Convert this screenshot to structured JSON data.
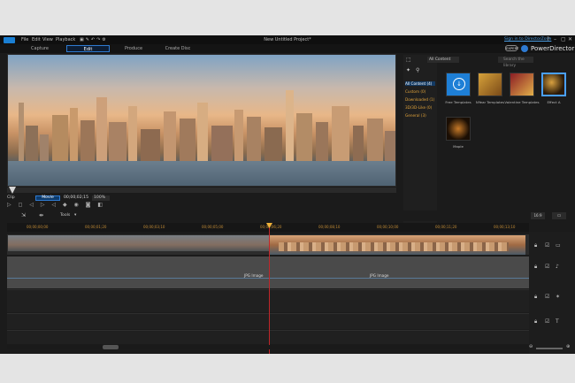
{
  "title_bar": {
    "menu": [
      "File",
      "Edit",
      "View",
      "Playback"
    ],
    "window_title": "New Untitled Project*",
    "sign_in": "Sign in to DirectorZone",
    "window_controls": [
      "?",
      "–",
      "▢",
      "✕"
    ]
  },
  "mode_tabs": [
    "Capture",
    "Edit",
    "Produce",
    "Create Disc"
  ],
  "brand": {
    "expert": "EXPERT",
    "name": "PowerDirector"
  },
  "preview": {
    "mode_clip": "Clip",
    "mode_movie": "Movie",
    "timecode": "00;00;02;15",
    "zoom": "100%",
    "controls": "▷ ◻ ◁ ▷ ◁ ◆ ◉ ◙ ◧"
  },
  "library": {
    "filter": "All Content",
    "search_placeholder": "Search the library",
    "categories": [
      "All Content (4)",
      "Custom (0)",
      "Downloaded (1)",
      "3D/3D-Like (0)",
      "General (3)"
    ],
    "items": [
      {
        "label": "Free Templates",
        "icon": "download-icon"
      },
      {
        "label": "NYear Templates"
      },
      {
        "label": "Valentine Templates"
      },
      {
        "label": "Effect A"
      },
      {
        "label": "Maple"
      }
    ]
  },
  "timeline_toolbar": {
    "tools_label": "Tools",
    "aspect": "16:9"
  },
  "ruler_ticks": [
    "00;00;00;00",
    "00;00;01;20",
    "00;00;03;10",
    "00;00;05;00",
    "00;00;06;20",
    "00;00;08;10",
    "00;00;10;00",
    "00;00;11;20",
    "00;00;13;10"
  ],
  "audio_clips": [
    "JPG Image",
    "JPG Image"
  ],
  "colors": {
    "accent": "#2e7ad1",
    "playhead": "#c0262a",
    "ruler_text": "#c08a35",
    "category": "#e0a23a"
  }
}
